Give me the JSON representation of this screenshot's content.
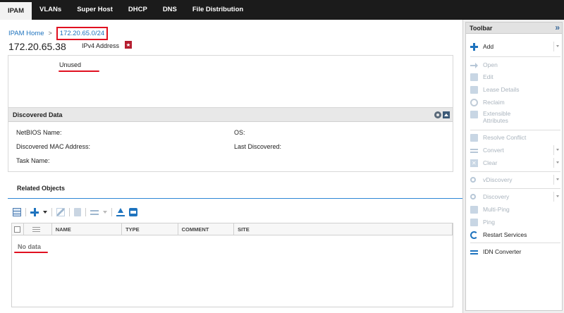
{
  "nav": {
    "tabs": [
      "IPAM",
      "VLANs",
      "Super Host",
      "DHCP",
      "DNS",
      "File Distribution"
    ],
    "active": "IPAM"
  },
  "breadcrumb": {
    "home": "IPAM Home",
    "separator": ">",
    "current": "172.20.65.0/24"
  },
  "header": {
    "ip": "172.20.65.38",
    "type": "IPv4 Address"
  },
  "status": {
    "text": "Unused"
  },
  "discovered": {
    "title": "Discovered Data",
    "fields": {
      "netbios": "NetBIOS Name:",
      "os": "OS:",
      "mac": "Discovered MAC Address:",
      "last": "Last Discovered:",
      "task": "Task Name:"
    }
  },
  "related": {
    "title": "Related Objects",
    "columns": [
      "NAME",
      "TYPE",
      "COMMENT",
      "SITE"
    ],
    "empty": "No data"
  },
  "toolbar": {
    "title": "Toolbar",
    "items": {
      "add": "Add",
      "open": "Open",
      "edit": "Edit",
      "lease": "Lease Details",
      "reclaim": "Reclaim",
      "ext1": "Extensible",
      "ext2": "Attributes",
      "resolve": "Resolve Conflict",
      "convert": "Convert",
      "clear": "Clear",
      "vdiscovery": "vDiscovery",
      "discovery": "Discovery",
      "multiping": "Multi-Ping",
      "ping": "Ping",
      "restart": "Restart Services",
      "idn": "IDN Converter"
    }
  },
  "colors": {
    "accent": "#1e73be",
    "highlight": "#e01020",
    "nav_bg": "#1b1b1b"
  }
}
